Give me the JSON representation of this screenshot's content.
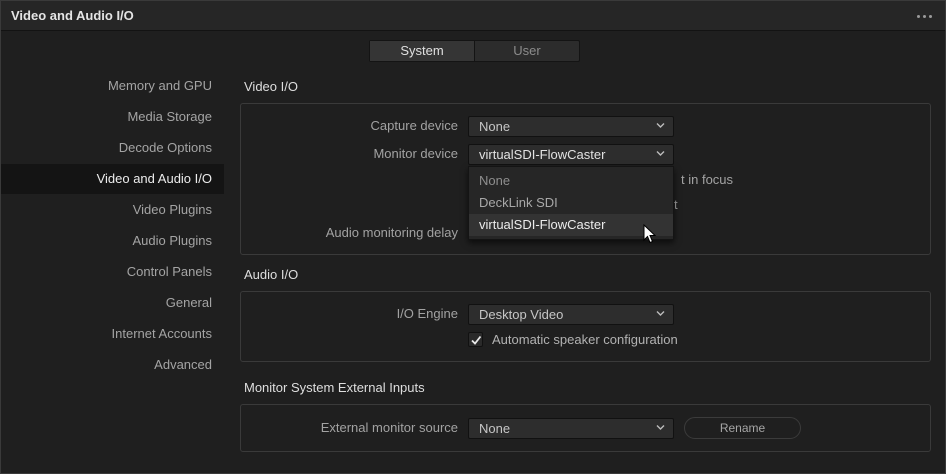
{
  "window": {
    "title": "Video and Audio I/O"
  },
  "tabs": [
    {
      "label": "System",
      "active": true
    },
    {
      "label": "User",
      "active": false
    }
  ],
  "sidebar": {
    "items": [
      {
        "label": "Memory and GPU"
      },
      {
        "label": "Media Storage"
      },
      {
        "label": "Decode Options"
      },
      {
        "label": "Video and Audio I/O",
        "active": true
      },
      {
        "label": "Video Plugins"
      },
      {
        "label": "Audio Plugins"
      },
      {
        "label": "Control Panels"
      },
      {
        "label": "General"
      },
      {
        "label": "Internet Accounts"
      },
      {
        "label": "Advanced"
      }
    ]
  },
  "video_io": {
    "title": "Video I/O",
    "capture_label": "Capture device",
    "capture_value": "None",
    "monitor_label": "Monitor device",
    "monitor_value": "virtualSDI-FlowCaster",
    "partial_text_1": "t in focus",
    "partial_text_2": "t",
    "audio_delay_label": "Audio monitoring delay"
  },
  "monitor_dropdown": {
    "options": [
      "None",
      "DeckLink SDI",
      "virtualSDI-FlowCaster"
    ],
    "selected": "virtualSDI-FlowCaster"
  },
  "audio_io": {
    "title": "Audio I/O",
    "engine_label": "I/O Engine",
    "engine_value": "Desktop Video",
    "speaker_label": "Automatic speaker configuration",
    "speaker_checked": true
  },
  "external_inputs": {
    "title": "Monitor System External Inputs",
    "source_label": "External monitor source",
    "source_value": "None",
    "rename_label": "Rename"
  },
  "colors": {
    "background": "#1f1f1f",
    "active_nav": "#141414",
    "panel_border": "#3a3a3a"
  }
}
